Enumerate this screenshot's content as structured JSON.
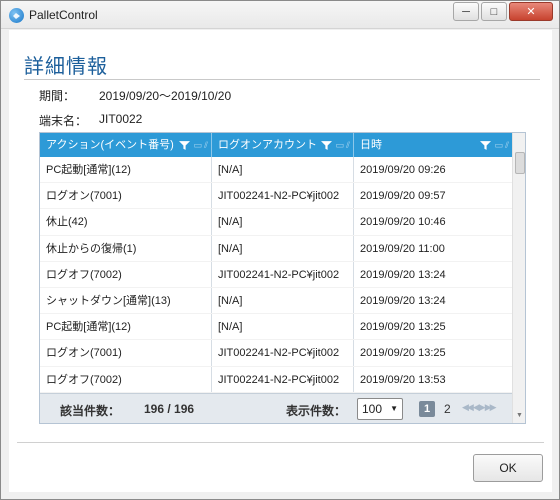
{
  "window": {
    "title": "PalletControl",
    "minimize_label": "─",
    "maximize_label": "□",
    "close_label": "✕"
  },
  "heading": "詳細情報",
  "meta": {
    "period_label": "期間：",
    "period_value": "2019/09/20～2019/10/20",
    "terminal_label": "端末名：",
    "terminal_value": "JIT0022"
  },
  "grid": {
    "columns": [
      "アクション(イベント番号)",
      "ログオンアカウント",
      "日時"
    ],
    "rows": [
      [
        "PC起動[通常](12)",
        "[N/A]",
        "2019/09/20 09:26"
      ],
      [
        "ログオン(7001)",
        "JIT002241-N2-PC¥jit002",
        "2019/09/20 09:57"
      ],
      [
        "休止(42)",
        "[N/A]",
        "2019/09/20 10:46"
      ],
      [
        "休止からの復帰(1)",
        "[N/A]",
        "2019/09/20 11:00"
      ],
      [
        "ログオフ(7002)",
        "JIT002241-N2-PC¥jit002",
        "2019/09/20 13:24"
      ],
      [
        "シャットダウン[通常](13)",
        "[N/A]",
        "2019/09/20 13:24"
      ],
      [
        "PC起動[通常](12)",
        "[N/A]",
        "2019/09/20 13:25"
      ],
      [
        "ログオン(7001)",
        "JIT002241-N2-PC¥jit002",
        "2019/09/20 13:25"
      ],
      [
        "ログオフ(7002)",
        "JIT002241-N2-PC¥jit002",
        "2019/09/20 13:53"
      ]
    ],
    "footer": {
      "count_label": "該当件数：",
      "count_value": "196 / 196",
      "show_label": "表示件数：",
      "page_size": "100",
      "current_page": "1",
      "next_page": "2"
    }
  },
  "ok_label": "OK",
  "colors": {
    "header_bg": "#2d9ad7",
    "heading_text": "#1c5f9b"
  }
}
